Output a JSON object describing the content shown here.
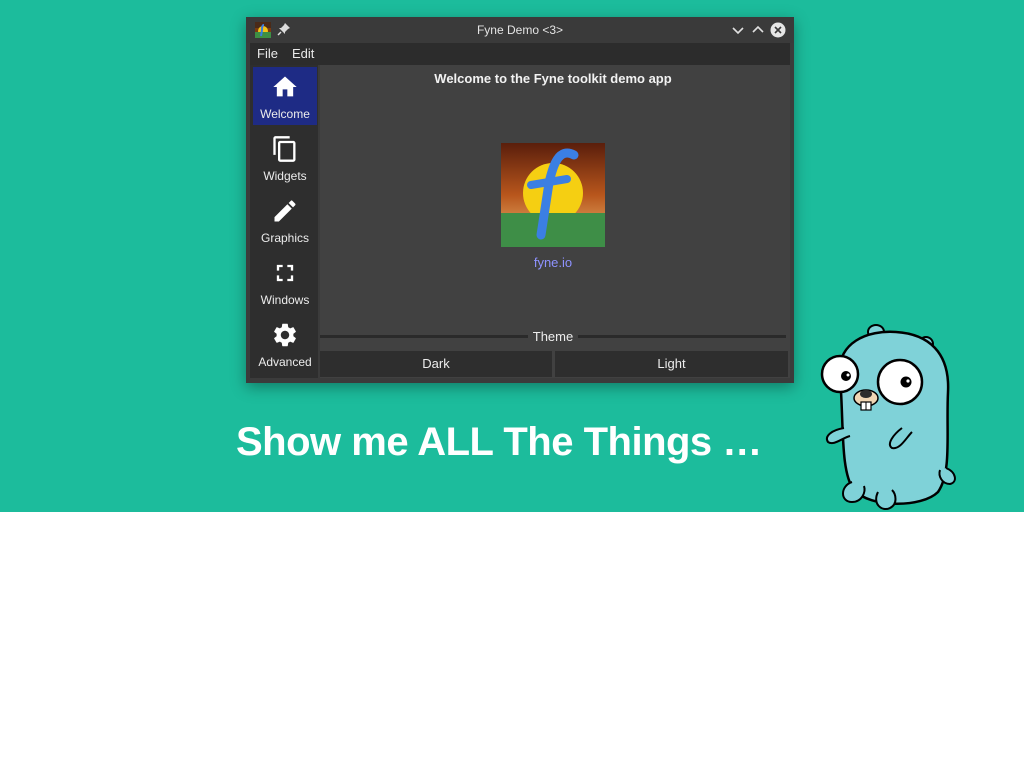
{
  "window": {
    "title": "Fyne Demo <3>"
  },
  "menu": {
    "items": [
      "File",
      "Edit"
    ]
  },
  "sidebar": {
    "items": [
      {
        "label": "Welcome",
        "icon": "home-icon",
        "active": true
      },
      {
        "label": "Widgets",
        "icon": "widgets-icon",
        "active": false
      },
      {
        "label": "Graphics",
        "icon": "pencil-icon",
        "active": false
      },
      {
        "label": "Windows",
        "icon": "fullscreen-icon",
        "active": false
      },
      {
        "label": "Advanced",
        "icon": "gear-icon",
        "active": false
      }
    ]
  },
  "content": {
    "welcome": "Welcome to the Fyne toolkit demo app",
    "link": "fyne.io",
    "theme_label": "Theme",
    "dark_button": "Dark",
    "light_button": "Light"
  },
  "slide": {
    "title": "Show me ALL The Things …"
  },
  "colors": {
    "slide_background": "#1cbc9c",
    "active_nav": "#1e2b85",
    "link": "#8e92ff"
  }
}
